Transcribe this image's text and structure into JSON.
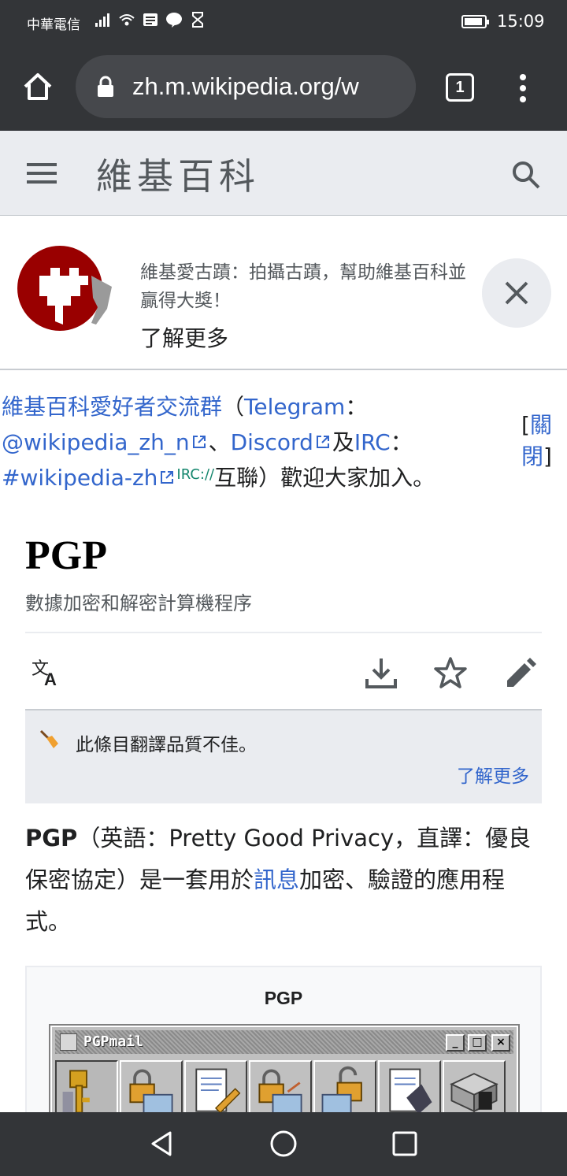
{
  "status_bar": {
    "carrier": "中華電信",
    "time": "15:09",
    "battery_level": 0.9
  },
  "browser": {
    "url": "zh.m.wikipedia.org/w",
    "tab_count": "1"
  },
  "wiki_header": {
    "logo_text": "維基百科"
  },
  "banner": {
    "text": "維基愛古蹟：拍攝古蹟，幫助維基百科並贏得大獎！",
    "link": "了解更多"
  },
  "sitenotice": {
    "group_link": "維基百科愛好者交流群",
    "paren_open": "（",
    "telegram": "Telegram",
    "colon1": "：",
    "telegram_handle": "@wikipedia_zh_n",
    "sep1": "、",
    "discord": "Discord",
    "and": "及",
    "irc": "IRC",
    "colon2": "：",
    "irc_channel": "#wikipedia-zh",
    "irc_sup": "IRC://",
    "tail": "互聯）歡迎大家加入。",
    "close_bracket_open": "[",
    "close_label": "關閉",
    "close_bracket_close": "]"
  },
  "article": {
    "title": "PGP",
    "description": "數據加密和解密計算機程序"
  },
  "page_actions": {
    "language_icon": "translate-icon",
    "download_icon": "download-icon",
    "watch_icon": "star-icon",
    "edit_icon": "pencil-icon"
  },
  "quality_notice": {
    "text": "此條目翻譯品質不佳。",
    "link": "了解更多"
  },
  "lead": {
    "bold_term": "PGP",
    "part1": "（英語：Pretty Good Privacy，直譯：優良保密協定）是一套用於",
    "link": "訊息",
    "part2": "加密、驗證的應用程式。"
  },
  "infobox": {
    "title": "PGP",
    "window_title": "PGPmail",
    "win_min": "_",
    "win_max": "□",
    "win_close": "×"
  }
}
